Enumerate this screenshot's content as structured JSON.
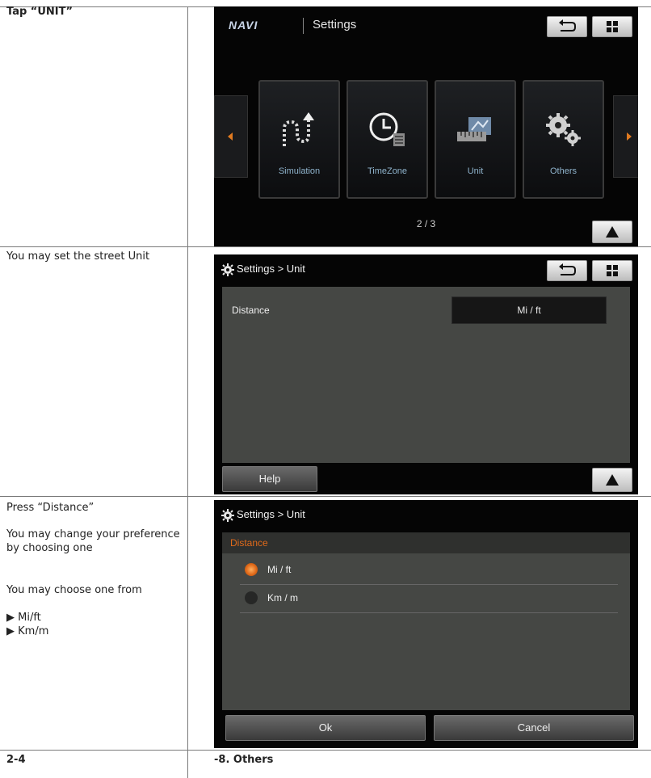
{
  "left": {
    "row1": "Tap “UNIT”",
    "row2": "You may set the street Unit",
    "row3_a": "Press “Distance”",
    "row3_b": "You may change your preference by choosing one",
    "row3_c": "You may choose one from",
    "row3_opt1": "▶  Mi/ft",
    "row3_opt2": "▶  Km/m"
  },
  "footer": {
    "page_number": "2-4",
    "section": "-8. Others"
  },
  "screen1": {
    "logo": "NAVI",
    "title": "Settings",
    "tiles": [
      "Simulation",
      "TimeZone",
      "Unit",
      "Others"
    ],
    "page_indicator": "2 / 3",
    "icons": {
      "back": "back-arrow-icon",
      "menu": "grid-menu-icon",
      "up": "up-arrow-icon"
    }
  },
  "screen2": {
    "breadcrumb": "Settings > Unit",
    "distance_label": "Distance",
    "distance_value": "Mi / ft",
    "help": "Help"
  },
  "screen3": {
    "breadcrumb": "Settings > Unit",
    "section_title": "Distance",
    "options": [
      {
        "label": "Mi / ft",
        "selected": true
      },
      {
        "label": "Km / m",
        "selected": false
      }
    ],
    "ok": "Ok",
    "cancel": "Cancel"
  },
  "colors": {
    "accent": "#e06a1a",
    "screen_bg": "#050505",
    "panel": "#454744"
  }
}
